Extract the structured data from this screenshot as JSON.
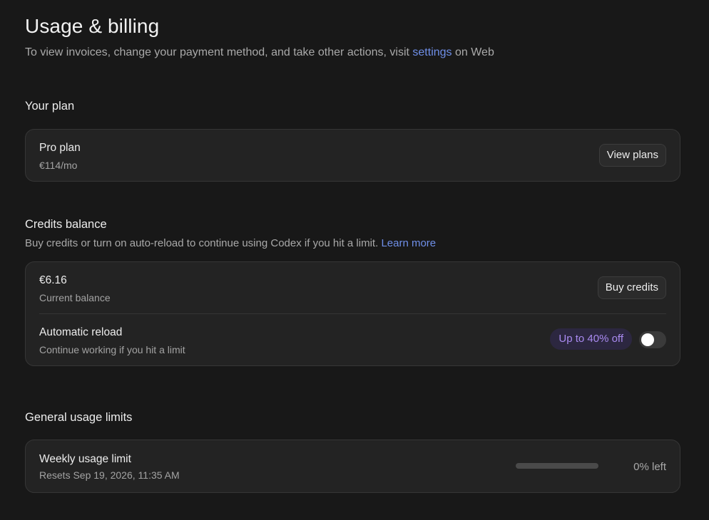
{
  "header": {
    "title": "Usage & billing",
    "subtitle_before": "To view invoices, change your payment method, and take other actions, visit ",
    "subtitle_link": "settings",
    "subtitle_after": " on Web"
  },
  "plan_section": {
    "heading": "Your plan",
    "plan_name": "Pro plan",
    "plan_price": "€114/mo",
    "view_plans_label": "View plans"
  },
  "credits_section": {
    "heading": "Credits balance",
    "description": "Buy credits or turn on auto-reload to continue using Codex if you hit a limit.",
    "learn_more_label": "Learn more",
    "balance_value": "€6.16",
    "balance_label": "Current balance",
    "buy_credits_label": "Buy credits",
    "auto_reload_title": "Automatic reload",
    "auto_reload_desc": "Continue working if you hit a limit",
    "discount_badge": "Up to 40% off",
    "auto_reload_enabled": false
  },
  "usage_section": {
    "heading": "General usage limits",
    "weekly_title": "Weekly usage limit",
    "weekly_reset": "Resets Sep 19, 2026, 11:35 AM",
    "weekly_remaining_label": "0% left",
    "weekly_remaining_fraction": 0
  },
  "colors": {
    "background": "#181818",
    "card": "#232323",
    "link": "#6f8fe8",
    "badge_text": "#a98af0",
    "badge_bg": "#2c2740"
  }
}
